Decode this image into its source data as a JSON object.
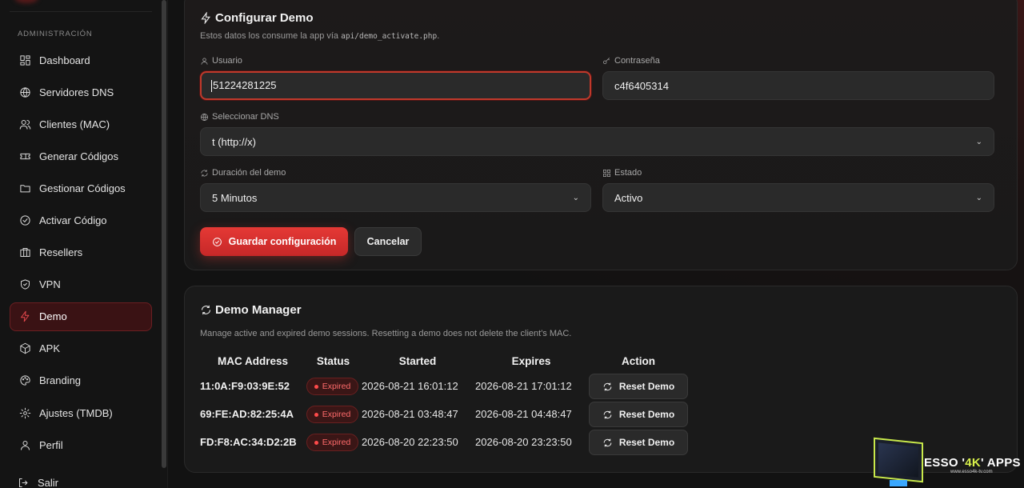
{
  "sidebar": {
    "section_title": "ADMINISTRACIÓN",
    "items": [
      {
        "label": "Dashboard",
        "icon": "dashboard-icon"
      },
      {
        "label": "Servidores DNS",
        "icon": "globe-icon"
      },
      {
        "label": "Clientes (MAC)",
        "icon": "users-icon"
      },
      {
        "label": "Generar Códigos",
        "icon": "ticket-icon"
      },
      {
        "label": "Gestionar Códigos",
        "icon": "folder-icon"
      },
      {
        "label": "Activar Código",
        "icon": "check-circle-icon"
      },
      {
        "label": "Resellers",
        "icon": "briefcase-icon"
      },
      {
        "label": "VPN",
        "icon": "shield-icon"
      },
      {
        "label": "Demo",
        "icon": "zap-icon",
        "active": true
      },
      {
        "label": "APK",
        "icon": "package-icon"
      },
      {
        "label": "Branding",
        "icon": "palette-icon"
      },
      {
        "label": "Ajustes (TMDB)",
        "icon": "settings-icon"
      },
      {
        "label": "Perfil",
        "icon": "user-icon"
      }
    ],
    "logout_label": "Salir"
  },
  "config": {
    "title": "Configurar Demo",
    "subtitle_prefix": "Estos datos los consume la app vía ",
    "subtitle_code": "api/demo_activate.php",
    "subtitle_suffix": ".",
    "usuario_label": "Usuario",
    "usuario_value": "51224281225",
    "password_label": "Contraseña",
    "password_value": "c4f6405314",
    "dns_label": "Seleccionar DNS",
    "dns_value": "t (http://x)",
    "duracion_label": "Duración del demo",
    "duracion_value": "5 Minutos",
    "estado_label": "Estado",
    "estado_value": "Activo",
    "save_label": "Guardar configuración",
    "cancel_label": "Cancelar"
  },
  "manager": {
    "title": "Demo Manager",
    "description": "Manage active and expired demo sessions. Resetting a demo does not delete the client's MAC.",
    "columns": [
      "MAC Address",
      "Status",
      "Started",
      "Expires",
      "Action"
    ],
    "rows": [
      {
        "mac": "11:0A:F9:03:9E:52",
        "status": "Expired",
        "started": "2026-08-21 16:01:12",
        "expires": "2026-08-21 17:01:12",
        "action": "Reset Demo"
      },
      {
        "mac": "69:FE:AD:82:25:4A",
        "status": "Expired",
        "started": "2026-08-21 03:48:47",
        "expires": "2026-08-21 04:48:47",
        "action": "Reset Demo"
      },
      {
        "mac": "FD:F8:AC:34:D2:2B",
        "status": "Expired",
        "started": "2026-08-20 22:23:50",
        "expires": "2026-08-20 23:23:50",
        "action": "Reset Demo"
      }
    ]
  },
  "brand": {
    "name_prefix": "ESSO '",
    "name_highlight": "4K",
    "name_suffix": "' APPS",
    "url": "www.esso4k-tv.com"
  },
  "colors": {
    "accent": "#e53935",
    "badge_text": "#ff6b6b",
    "brand_highlight": "#d8f04a"
  }
}
